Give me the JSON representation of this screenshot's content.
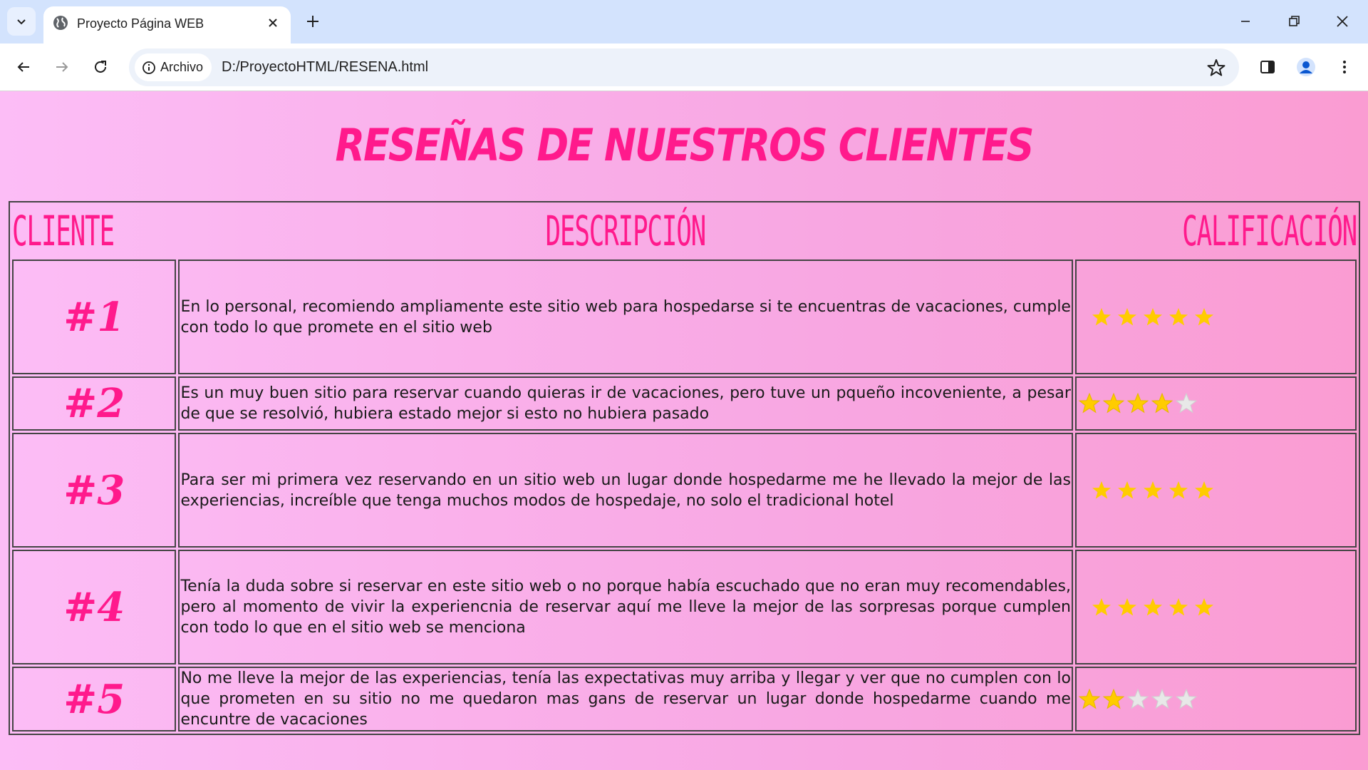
{
  "browser": {
    "tab_title": "Proyecto Página WEB",
    "chip_label": "Archivo",
    "url": "D:/ProyectoHTML/RESENA.html",
    "icons": [
      "tab-search-icon",
      "globe-icon",
      "close-icon",
      "plus-icon",
      "minimize-icon",
      "restore-icon",
      "close-window-icon",
      "back-icon",
      "forward-icon",
      "reload-icon",
      "info-icon",
      "star-icon",
      "side-panel-icon",
      "profile-icon",
      "menu-icon"
    ]
  },
  "page": {
    "title": "RESEÑAS DE NUESTROS CLIENTES",
    "headers": {
      "cliente": "CLIENTE",
      "descripcion": "DESCRIPCIÓN",
      "calificacion": "CALIFICACIÓN"
    },
    "reviews": [
      {
        "client": "#1",
        "text": "En lo personal, recomiendo ampliamente este sitio web para hospedarse si te encuentras de vacaciones, cumple con todo lo que promete en el sitio web",
        "rating": 5
      },
      {
        "client": "#2",
        "text": "Es un muy buen sitio para reservar cuando quieras ir de vacaciones, pero tuve un pqueño incoveniente, a pesar de que se resolvió, hubiera estado mejor si esto no hubiera pasado",
        "rating": 4
      },
      {
        "client": "#3",
        "text": "Para ser mi primera vez reservando en un sitio web un lugar donde hospedarme me he llevado la mejor de las experiencias, increíble que tenga muchos modos de hospedaje, no solo el tradicional hotel",
        "rating": 5
      },
      {
        "client": "#4",
        "text": "Tenía la duda sobre si reservar en este sitio web o no porque había escuchado que no eran muy recomendables, pero al momento de vivir la experiencnia de reservar aquí me lleve la mejor de las sorpresas porque cumplen con todo lo que en el sitio web se menciona",
        "rating": 5
      },
      {
        "client": "#5",
        "text": "No me lleve la mejor de las experiencias, tenía las expectativas muy arriba y llegar y ver que no cumplen con lo que prometen en su sitio no me quedaron mas gans de reservar un lugar donde hospedarme cuando me encuntre de vacaciones",
        "rating": 2
      }
    ],
    "colors": {
      "accent": "#ff1a8c",
      "star_filled": "#ffcc00",
      "star_empty": "#e8e8e8"
    }
  }
}
